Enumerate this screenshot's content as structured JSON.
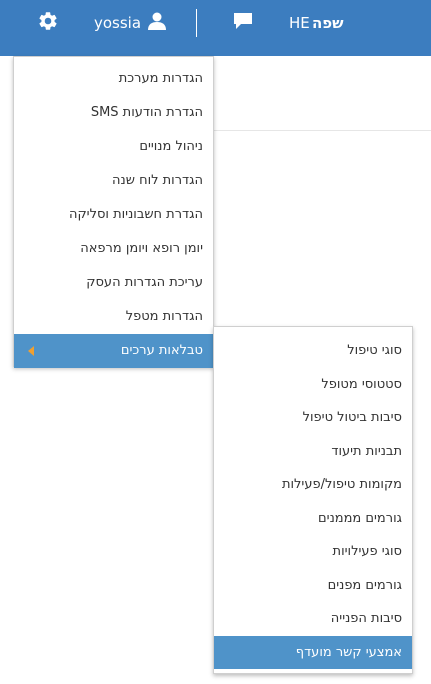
{
  "header": {
    "username": "yossia",
    "language_code": "HE",
    "language_label": "שפה",
    "icons": {
      "settings": "gear-icon",
      "user": "user-icon",
      "messages": "chat-icon"
    },
    "background_color": "#3c7dbf"
  },
  "main_menu": {
    "items": [
      {
        "label": "הגדרות מערכת"
      },
      {
        "label": "הגדרת הודעות SMS"
      },
      {
        "label": "ניהול מנויים"
      },
      {
        "label": "הגדרות לוח שנה"
      },
      {
        "label": "הגדרת חשבוניות וסליקה"
      },
      {
        "label": "יומן רופא ויומן מרפאה"
      },
      {
        "label": "עריכת הגדרות העסק"
      },
      {
        "label": "הגדרות מטפל"
      },
      {
        "label": "טבלאות ערכים",
        "active": true,
        "has_submenu": true
      }
    ]
  },
  "submenu": {
    "items": [
      {
        "label": "סוגי טיפול"
      },
      {
        "label": "סטטוסי מטופל"
      },
      {
        "label": "סיבות ביטול טיפול"
      },
      {
        "label": "תבניות תיעוד"
      },
      {
        "label": "מקומות טיפול/פעילות"
      },
      {
        "label": "גורמים מממנים"
      },
      {
        "label": "סוגי פעילויות"
      },
      {
        "label": "גורמים מפנים"
      },
      {
        "label": "סיבות הפנייה"
      },
      {
        "label": "אמצעי קשר מועדף",
        "active": true
      }
    ]
  },
  "colors": {
    "active_item": "#4f93c9",
    "submenu_caret": "#f0a030"
  }
}
